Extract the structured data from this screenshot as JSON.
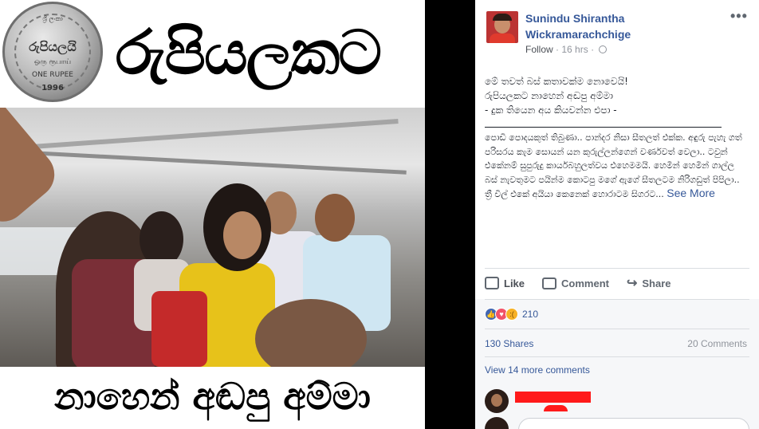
{
  "image_post": {
    "coin": {
      "top_text": "ශ්‍රී ලංකා",
      "script": "රුපියලයි",
      "tamil": "ஒரு ரூபாய்",
      "english": "ONE RUPEE",
      "year": "1996"
    },
    "headline": "රුපියලකට",
    "caption": "නාහෙන් අඬපු අම්මා"
  },
  "post": {
    "author_first": "Sunindu Shirantha",
    "author_second": "Wickramarachchige",
    "follow_label": "Follow",
    "time": "16 hrs",
    "more_label": "•••",
    "intro_lines": [
      "මේ තවත් බස් කතාවක්ම නොවෙයි!",
      "රුපියලකට නාහෙන් අඬපු අම්මා",
      "- දුක තියෙන අය කියවන්න එපා -"
    ],
    "body": "පොඩි පොදයකුත් තිබුණා.. පාන්දර නිසා සීතලත් එක්ක. අඳුරු පැහැ ගත් පරිසරය කැම සොයන් යන කුරුල්ලන්ගෙන් වර්ණවත් වෙලා.. ටවුන් එකේනම් සුපුරුදු කාර්යබහුලත්වය එහෙමමයි. හෙමින් හෙමින් ගාල්ල බස් නැවතුමට පයින්ම කොටපු මගේ ඇගේ සීතලටම නිරිගඩුත් පිපිලා.. ත්‍රී වීල් එකේ අයියා කෙනෙක් හොරාටම සිගරට...",
    "see_more": "See More",
    "actions": {
      "like": "Like",
      "comment": "Comment",
      "share": "Share"
    },
    "reaction_count": "210",
    "shares": "130 Shares",
    "comments": "20 Comments",
    "view_more": "View 14 more comments"
  },
  "colors": {
    "link": "#365899",
    "muted": "#90949c",
    "redaction": "#ff1a1a"
  }
}
